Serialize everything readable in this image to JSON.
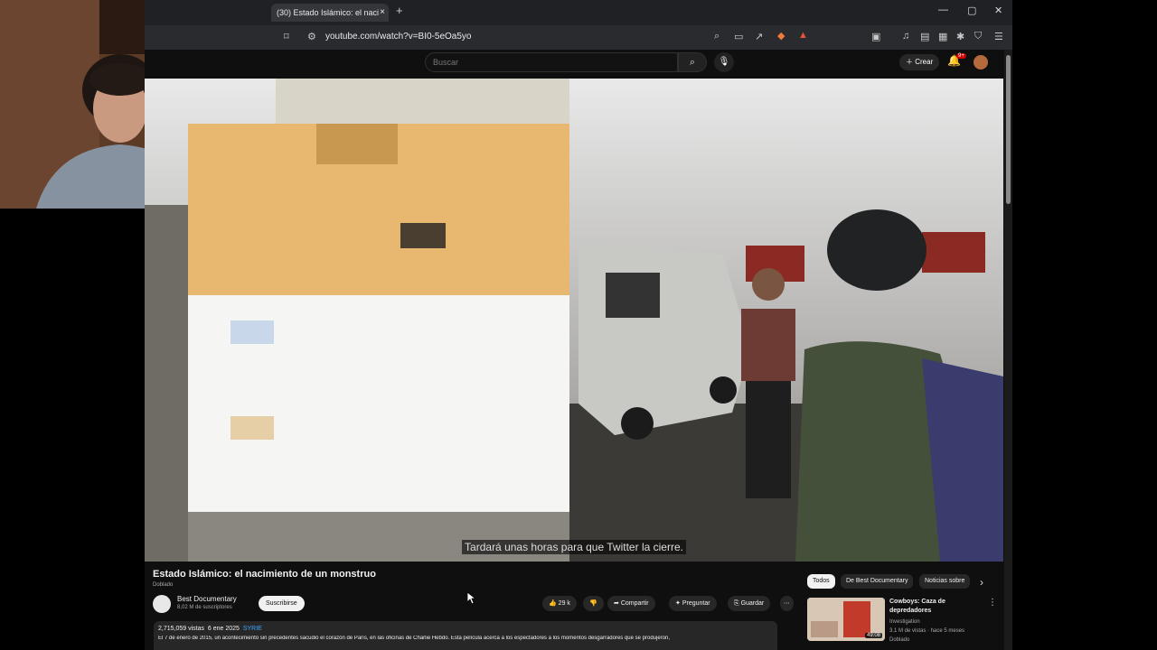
{
  "browser": {
    "tab_title": "(30) Estado Islámico: el naci",
    "tab_close": "×",
    "new_tab": "+",
    "url": "youtube.com/watch?v=BI0-5eOa5yo",
    "window_controls": [
      "—",
      "▢",
      "✕"
    ]
  },
  "youtube": {
    "search_placeholder": "Buscar",
    "create_label": "Crear",
    "notifications_count": "9+",
    "video": {
      "subtitle": "Tardará unas horas para que Twitter la cierre.",
      "title": "Estado Islámico: el nacimiento de un monstruo",
      "dubbed": "Doblado",
      "channel_name": "Best Documentary",
      "subscribers": "8,02 M de suscriptores",
      "subscribe_label": "Suscribirse",
      "likes": "29 k",
      "share_label": "Compartir",
      "ask_label": "Preguntar",
      "save_label": "Guardar",
      "more_label": "⋯",
      "views": "2,715,059 vistas",
      "date": "6 ene 2025",
      "tag": "SYRIE",
      "description": "El 7 de enero de 2015, un acontecimiento sin precedentes sacudió el corazón de París, en las oficinas de Charlie Hebdo. Esta película acerca a los espectadores a los momentos desgarradores que se produjeron,"
    },
    "chips": [
      "Todos",
      "De Best Documentary",
      "Noticias sobre"
    ],
    "chips_next": "›",
    "recommendation": {
      "title": "Cowboys: Caza de depredadores",
      "channel": "Investigation",
      "meta": "3.1 M de vistas · hace 5 meses",
      "dubbed": "Doblado",
      "duration": "49:08",
      "menu": "⋮"
    }
  },
  "colors": {
    "youtube_bg": "#0f0f0f",
    "chrome_bg": "#202124",
    "link_blue": "#3ea6ff",
    "subscribe_bg": "#f1f1f1"
  }
}
